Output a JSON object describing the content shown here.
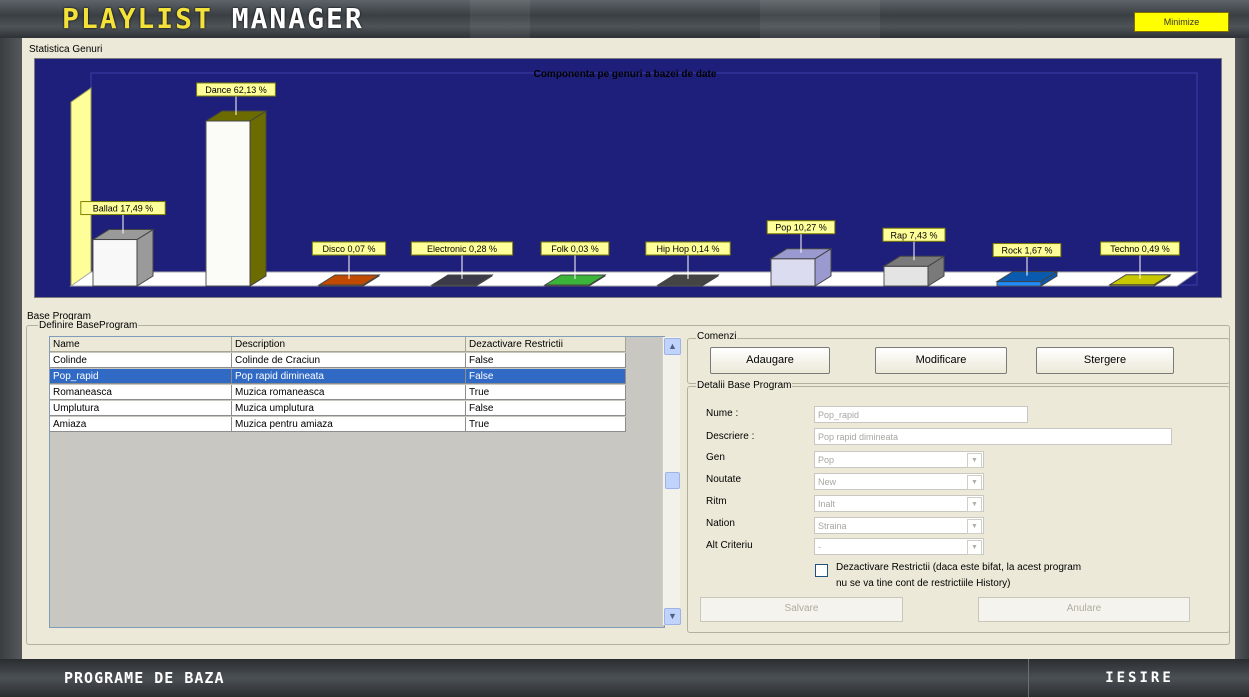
{
  "app": {
    "title_part1": "Playlist",
    "title_part2": "Manager",
    "minimize_label": "Minimize"
  },
  "stats_group_label": "Statistica Genuri",
  "chart_data": {
    "type": "bar",
    "title": "Componenta pe genuri a bazei de date",
    "categories": [
      "Ballad",
      "Dance",
      "Disco",
      "Electronic",
      "Folk",
      "Hip Hop",
      "Pop",
      "Rap",
      "Rock",
      "Techno"
    ],
    "values": [
      17.49,
      62.13,
      0.07,
      0.28,
      0.03,
      0.14,
      10.27,
      7.43,
      1.67,
      0.49
    ],
    "labels": [
      "Ballad 17,49 %",
      "Dance 62,13 %",
      "Disco 0,07 %",
      "Electronic 0,28 %",
      "Folk 0,03 %",
      "Hip Hop 0,14 %",
      "Pop 10,27 %",
      "Rap 7,43 %",
      "Rock 1,67 %",
      "Techno 0,49 %"
    ],
    "colors": [
      "#f8f8f8",
      "#fbfbf8",
      "#ff6600",
      "#555566",
      "#66ff66",
      "#6a6a6a",
      "#dcdcf0",
      "#e4e4e4",
      "#1e8cff",
      "#ffff00"
    ],
    "side_colors": [
      "#9a9a9a",
      "#6b6b00",
      "#c04a00",
      "#3a3a48",
      "#3ab53a",
      "#444444",
      "#9a9ad0",
      "#7a7a7a",
      "#0a5ab0",
      "#c8c800"
    ],
    "background": "#1e1f7a",
    "floor_color": "#ffffff",
    "wall_color": "#ffff99",
    "xlabel": "",
    "ylabel": "",
    "legend": "none"
  },
  "base_program": {
    "group_label": "Base Program",
    "define_label": "Definire BaseProgram",
    "columns": [
      "Name",
      "Description",
      "Dezactivare Restrictii"
    ],
    "rows": [
      {
        "name": "Colinde",
        "description": "Colinde de Craciun",
        "restrict": "False",
        "selected": false
      },
      {
        "name": "Pop_rapid",
        "description": "Pop rapid dimineata",
        "restrict": "False",
        "selected": true
      },
      {
        "name": "Romaneasca",
        "description": "Muzica romaneasca",
        "restrict": "True",
        "selected": false
      },
      {
        "name": "Umplutura",
        "description": "Muzica umplutura",
        "restrict": "False",
        "selected": false
      },
      {
        "name": "Amiaza",
        "description": "Muzica pentru amiaza",
        "restrict": "True",
        "selected": false
      }
    ]
  },
  "commands": {
    "group_label": "Comenzi",
    "add_label": "Adaugare",
    "modify_label": "Modificare",
    "delete_label": "Stergere"
  },
  "details": {
    "group_label": "Detalii Base Program",
    "name_label": "Nume :",
    "name_value": "Pop_rapid",
    "desc_label": "Descriere :",
    "desc_value": "Pop rapid dimineata",
    "gen_label": "Gen",
    "gen_value": "Pop",
    "noutate_label": "Noutate",
    "noutate_value": "New",
    "ritm_label": "Ritm",
    "ritm_value": "Inalt",
    "nation_label": "Nation",
    "nation_value": "Straina",
    "alt_label": "Alt Criteriu",
    "alt_value": "-",
    "checkbox_text_line1": "Dezactivare Restrictii (daca este bifat, la acest program",
    "checkbox_text_line2": "nu se va tine cont de restrictiile History)",
    "save_label": "Salvare",
    "cancel_label": "Anulare"
  },
  "footer": {
    "title": "Programe de baza",
    "exit_label": "IESIRE"
  }
}
